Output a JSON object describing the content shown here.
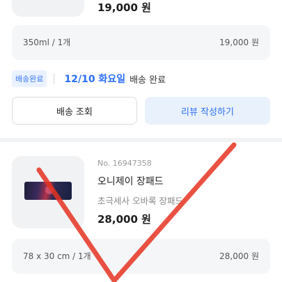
{
  "top_item": {
    "price": "19,000 원"
  },
  "top_option": {
    "option": "350ml / 1개",
    "amount": "19,000 원"
  },
  "shipping": {
    "badge": "배송완료",
    "date": "12/10 화요일",
    "status": "배송 완료"
  },
  "buttons": {
    "track": "배송 조회",
    "review": "리뷰 작성하기"
  },
  "product": {
    "order_no": "No. 16947358",
    "name": "오니제이 장패드",
    "desc": "초극세사 오바록 장패드",
    "price": "28,000 원",
    "image": "mousepad-image"
  },
  "bottom_option": {
    "option": "78 x 30 cm / 1개",
    "amount": "28,000 원"
  },
  "colors": {
    "accent": "#2b6ef5",
    "badge_bg": "#eaf1ff",
    "review_bg": "#e9f1fc",
    "checkmark": "#e53321"
  }
}
